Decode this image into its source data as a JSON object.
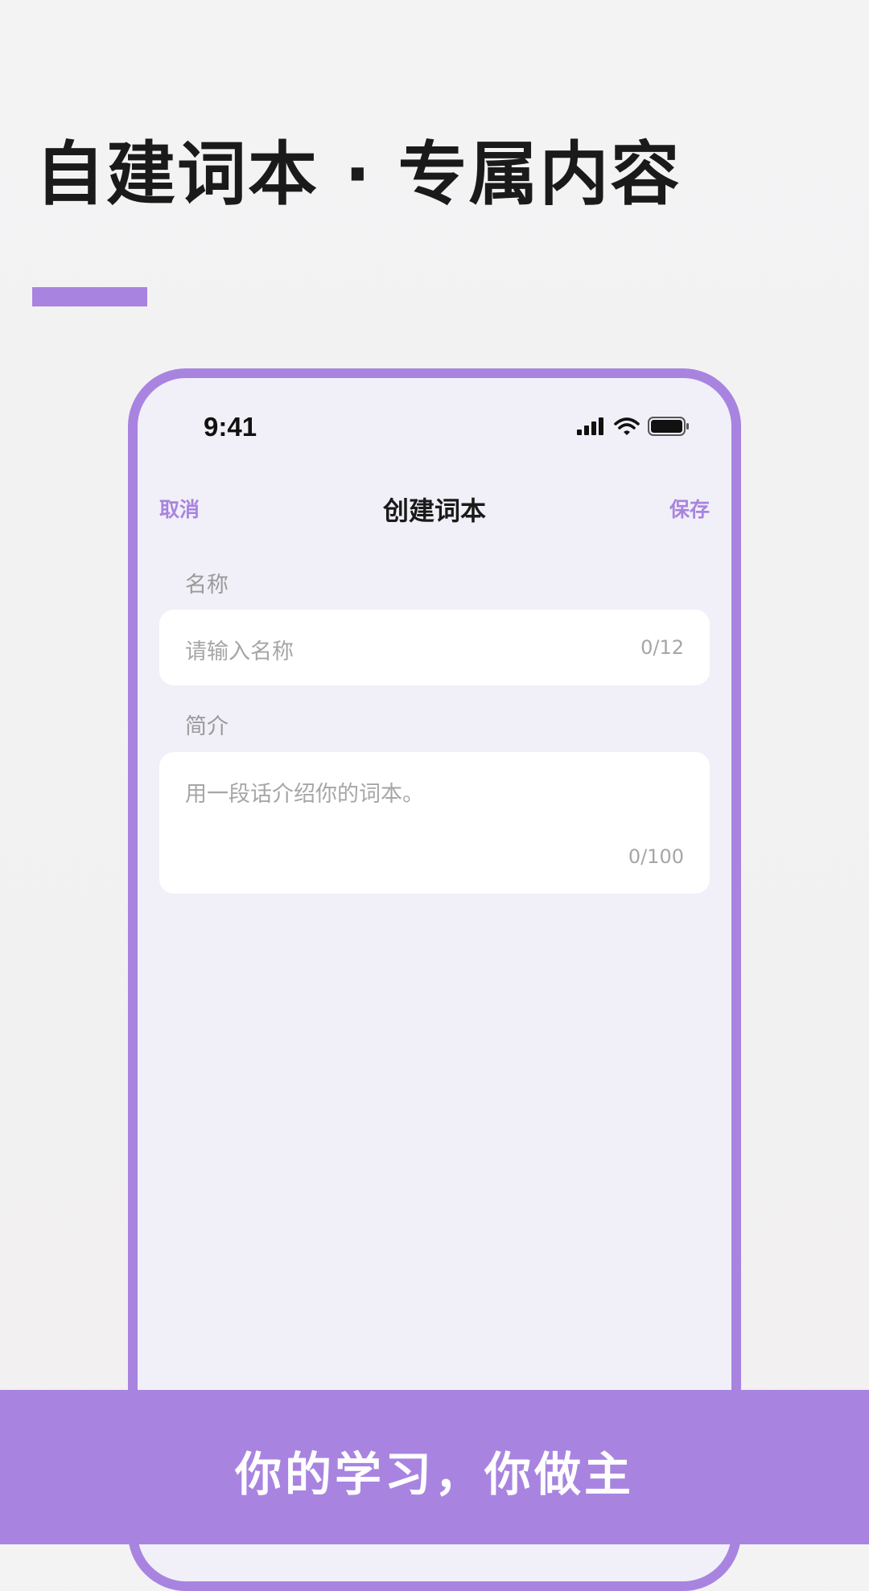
{
  "headline": "自建词本 · 专属内容",
  "colors": {
    "accent": "#a884e0",
    "text_dark": "#1a1a1a",
    "text_placeholder": "#a6a6a6",
    "phone_bg": "#f1f0f8"
  },
  "phone": {
    "status_bar": {
      "time": "9:41",
      "icons": [
        "cellular-signal-icon",
        "wifi-icon",
        "battery-icon"
      ]
    },
    "nav": {
      "cancel_label": "取消",
      "title": "创建词本",
      "save_label": "保存"
    },
    "form": {
      "name": {
        "label": "名称",
        "placeholder": "请输入名称",
        "counter": "0/12"
      },
      "description": {
        "label": "简介",
        "placeholder": "用一段话介绍你的词本。",
        "counter": "0/100"
      }
    }
  },
  "footer": {
    "slogan": "你的学习，你做主"
  }
}
